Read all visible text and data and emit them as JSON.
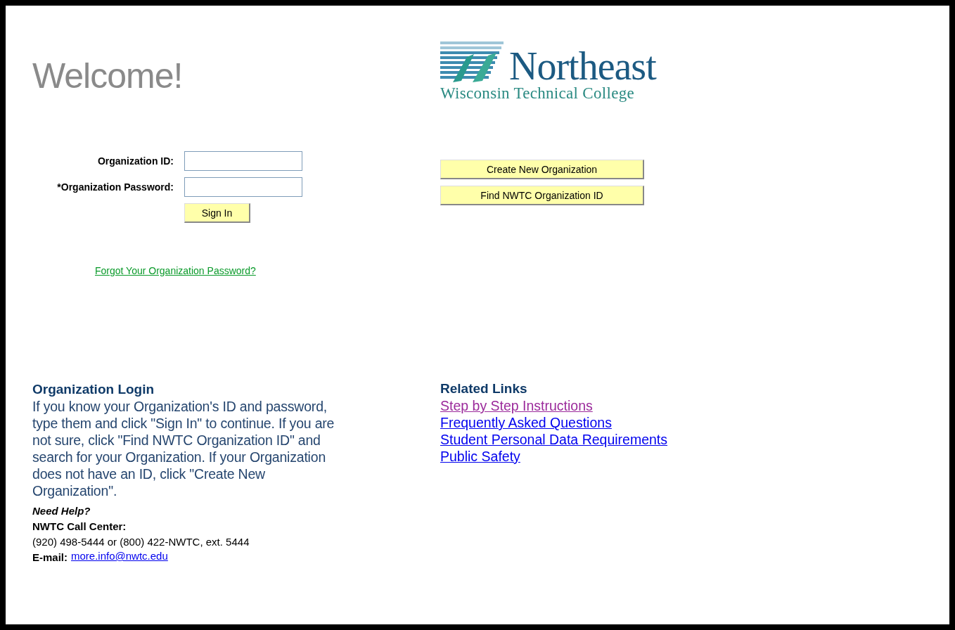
{
  "heading": "Welcome!",
  "logo": {
    "name": "Northeast",
    "subtitle": "Wisconsin Technical College"
  },
  "form": {
    "fields": [
      {
        "label": "Organization ID:"
      },
      {
        "label": "*Organization Password:"
      }
    ],
    "submit": "Sign In",
    "forgot_link": "Forgot Your Organization Password?"
  },
  "actions": [
    "Create New Organization",
    "Find NWTC Organization ID"
  ],
  "login_info": {
    "title": "Organization Login",
    "text": "If you know your Organization's ID and password, type them and click \"Sign In\" to continue. If you are not sure, click \"Find NWTC Organization ID\" and search for your Organization. If your Organization does not have an ID, click \"Create New Organization\".",
    "help_title": "Need Help?",
    "call_center_label": "NWTC Call Center:",
    "phone": "(920) 498-5444 or (800) 422-NWTC, ext. 5444",
    "email_label": "E-mail:",
    "email": "more.info@nwtc.edu"
  },
  "related_links": {
    "title": "Related Links",
    "links": [
      {
        "label": "Step by Step Instructions",
        "visited": true
      },
      {
        "label": "Frequently Asked Questions",
        "visited": false
      },
      {
        "label": "Student Personal Data Requirements",
        "visited": false
      },
      {
        "label": "Public Safety",
        "visited": false
      }
    ]
  }
}
